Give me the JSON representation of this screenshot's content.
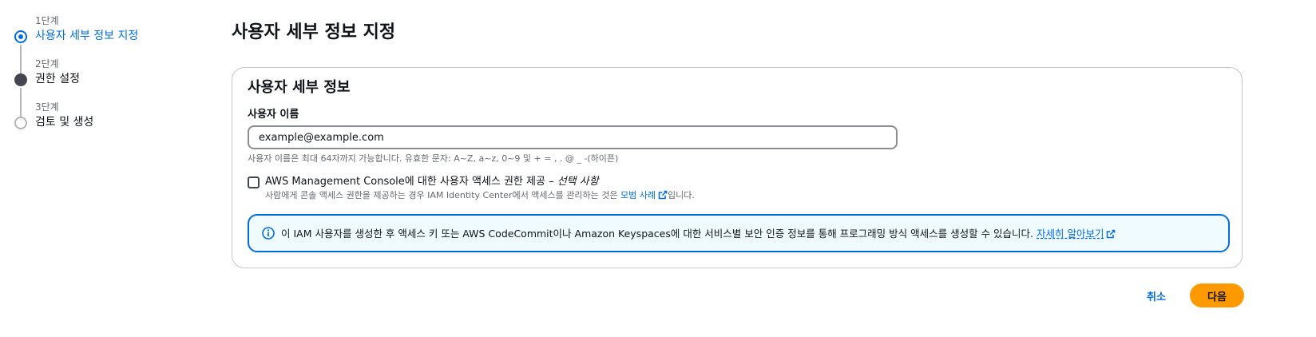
{
  "wizard": {
    "steps": [
      {
        "number": "1단계",
        "label": "사용자 세부 정보 지정",
        "state": "current"
      },
      {
        "number": "2단계",
        "label": "권한 설정",
        "state": "filled"
      },
      {
        "number": "3단계",
        "label": "검토 및 생성",
        "state": "empty"
      }
    ]
  },
  "page": {
    "title": "사용자 세부 정보 지정"
  },
  "panel": {
    "title": "사용자 세부 정보",
    "username": {
      "label": "사용자 이름",
      "value": "example@example.com",
      "hint": "사용자 이름은 최대 64자까지 가능합니다. 유효한 문자: A~Z, a~z, 0~9 및 + = , . @ _ -(하이픈)"
    },
    "console_access": {
      "checked": false,
      "label": "AWS Management Console에 대한 사용자 액세스 권한 제공 –",
      "label_optional": "선택 사항",
      "desc_prefix": "사람에게 콘솔 액세스 권한을 제공하는 경우 IAM Identity Center에서 액세스를 관리하는 것은",
      "desc_link": "모범 사례",
      "desc_suffix": "입니다."
    },
    "info_alert": {
      "icon": "info-icon",
      "text": "이 IAM 사용자를 생성한 후 액세스 키 또는 AWS CodeCommit이나 Amazon Keyspaces에 대한 서비스별 보안 인증 정보를 통해 프로그래밍 방식 액세스를 생성할 수 있습니다.",
      "link": "자세히 알아보기"
    }
  },
  "actions": {
    "cancel": "취소",
    "next": "다음"
  },
  "colors": {
    "accent": "#006ce0",
    "primary_button": "#ff9900",
    "alert_bg": "#f0fbff"
  }
}
